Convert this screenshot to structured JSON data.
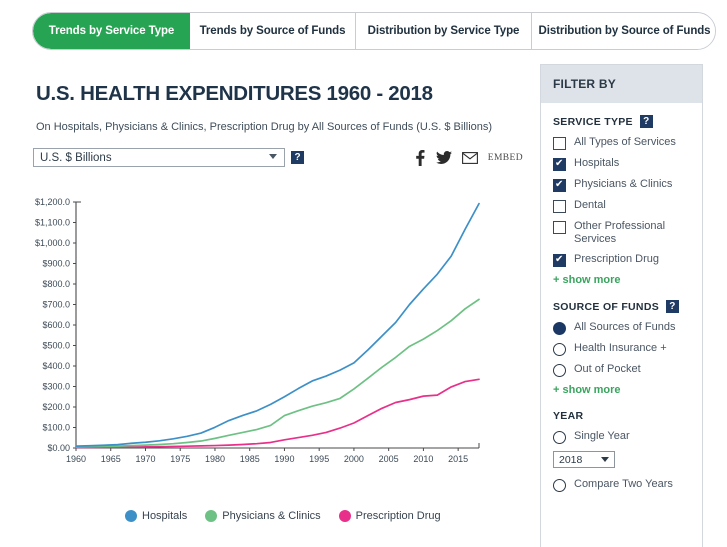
{
  "tabs": [
    {
      "label": "Trends by Service Type",
      "active": true
    },
    {
      "label": "Trends by Source of Funds",
      "active": false
    },
    {
      "label": "Distribution by Service Type",
      "active": false
    },
    {
      "label": "Distribution by Source of Funds",
      "active": false
    }
  ],
  "header": {
    "title": "U.S. HEALTH EXPENDITURES 1960 - 2018",
    "subtitle": "On Hospitals, Physicians & Clinics, Prescription Drug by All Sources of Funds (U.S. $ Billions)",
    "unit_selected": "U.S. $ Billions",
    "help_glyph": "?",
    "embed_label": "EMBED"
  },
  "filter": {
    "panel_title": "FILTER BY",
    "service_type": {
      "title": "SERVICE TYPE",
      "help_glyph": "?",
      "options": [
        {
          "label": "All Types of Services",
          "checked": false
        },
        {
          "label": "Hospitals",
          "checked": true
        },
        {
          "label": "Physicians & Clinics",
          "checked": true
        },
        {
          "label": "Dental",
          "checked": false
        },
        {
          "label": "Other Professional Services",
          "checked": false
        },
        {
          "label": "Prescription Drug",
          "checked": true
        }
      ],
      "show_more": "+ show more"
    },
    "source_of_funds": {
      "title": "SOURCE OF FUNDS",
      "help_glyph": "?",
      "options": [
        {
          "label": "All Sources of Funds",
          "selected": true
        },
        {
          "label": "Health Insurance +",
          "selected": false
        },
        {
          "label": "Out of Pocket",
          "selected": false
        }
      ],
      "show_more": "+ show more"
    },
    "year": {
      "title": "YEAR",
      "single_year_label": "Single Year",
      "single_year_selected": false,
      "year_value": "2018",
      "compare_label": "Compare Two Years",
      "compare_selected": false
    }
  },
  "colors": {
    "accent_green": "#27a453",
    "navy": "#1f3a63",
    "hospitals": "#3d90c7",
    "physicians": "#6ec184",
    "prescription": "#e8308a",
    "panel_header": "#dde3e8"
  },
  "chart_data": {
    "type": "line",
    "title": "U.S. HEALTH EXPENDITURES 1960 - 2018",
    "xlabel": "",
    "ylabel": "U.S. $ Billions",
    "xlim": [
      1960,
      2018
    ],
    "ylim": [
      0,
      1200
    ],
    "grid": false,
    "legend_position": "bottom",
    "xticks": [
      1960,
      1965,
      1970,
      1975,
      1980,
      1985,
      1990,
      1995,
      2000,
      2005,
      2010,
      2015
    ],
    "yticks": [
      0,
      100,
      200,
      300,
      400,
      500,
      600,
      700,
      800,
      900,
      1000,
      1100,
      1200
    ],
    "ytick_labels": [
      "$0.00",
      "$100.0",
      "$200.0",
      "$300.0",
      "$400.0",
      "$500.0",
      "$600.0",
      "$700.0",
      "$800.0",
      "$900.0",
      "$1,000.0",
      "$1,100.0",
      "$1,200.0"
    ],
    "x": [
      1960,
      1962,
      1964,
      1966,
      1968,
      1970,
      1972,
      1974,
      1976,
      1978,
      1980,
      1982,
      1984,
      1986,
      1988,
      1990,
      1992,
      1994,
      1996,
      1998,
      2000,
      2002,
      2004,
      2006,
      2008,
      2010,
      2012,
      2014,
      2016,
      2018
    ],
    "series": [
      {
        "name": "Hospitals",
        "color": "#3d90c7",
        "values": [
          9.0,
          11.0,
          13.5,
          16.5,
          23.0,
          28.0,
          35.0,
          45.0,
          57.0,
          73.0,
          101.0,
          134.0,
          159.0,
          181.0,
          213.0,
          250.0,
          290.0,
          327.0,
          351.0,
          380.0,
          415.0,
          478.0,
          545.0,
          612.0,
          700.0,
          776.0,
          848.0,
          936.0,
          1067.0,
          1192.0
        ]
      },
      {
        "name": "Physicians & Clinics",
        "color": "#6ec184",
        "values": [
          5.4,
          6.4,
          7.8,
          9.3,
          11.5,
          14.0,
          17.0,
          21.0,
          27.0,
          34.0,
          47.0,
          62.0,
          76.0,
          90.0,
          110.0,
          158.0,
          182.0,
          204.0,
          221.0,
          242.0,
          288.0,
          340.0,
          393.0,
          442.0,
          496.0,
          531.0,
          573.0,
          621.0,
          679.0,
          725.0
        ]
      },
      {
        "name": "Prescription Drug",
        "color": "#e8308a",
        "values": [
          2.7,
          3.1,
          3.5,
          4.0,
          4.7,
          5.5,
          6.4,
          7.5,
          8.8,
          10.5,
          12.0,
          14.0,
          17.0,
          21.0,
          27.0,
          40.0,
          51.0,
          62.0,
          76.0,
          97.0,
          122.0,
          158.0,
          193.0,
          222.0,
          236.0,
          253.0,
          258.0,
          298.0,
          324.0,
          335.0
        ]
      }
    ]
  },
  "legend": [
    {
      "label": "Hospitals",
      "color": "#3d90c7"
    },
    {
      "label": "Physicians & Clinics",
      "color": "#6ec184"
    },
    {
      "label": "Prescription Drug",
      "color": "#e8308a"
    }
  ]
}
